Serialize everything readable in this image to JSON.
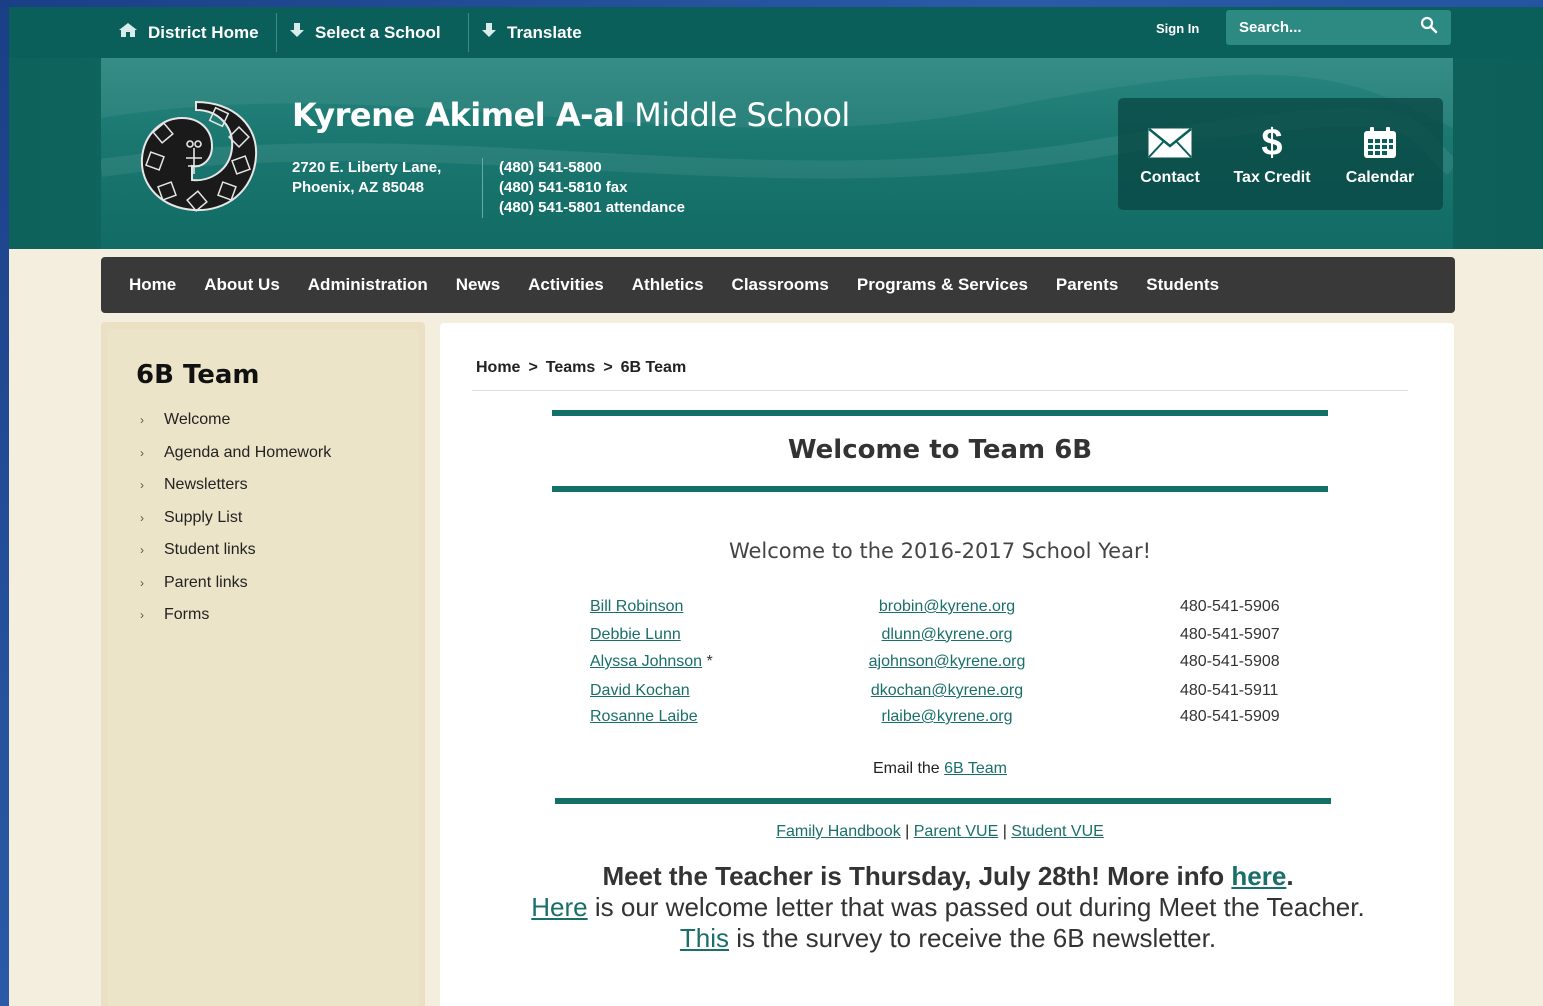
{
  "topbar": {
    "district_home": "District Home",
    "select_school": "Select a School",
    "translate": "Translate",
    "sign_in": "Sign In",
    "search_placeholder": "Search..."
  },
  "header": {
    "school_name_bold": "Kyrene Akimel A-al",
    "school_name_rest": "Middle School",
    "address_line1": "2720 E. Liberty Lane,",
    "address_line2": "Phoenix, AZ 85048",
    "phone": "(480) 541-5800",
    "fax": "(480) 541-5810 fax",
    "attendance": "(480) 541-5801 attendance",
    "quick_links": [
      {
        "label": "Contact",
        "icon": "envelope-icon"
      },
      {
        "label": "Tax Credit",
        "icon": "dollar-icon"
      },
      {
        "label": "Calendar",
        "icon": "calendar-icon"
      }
    ]
  },
  "nav": [
    "Home",
    "About Us",
    "Administration",
    "News",
    "Activities",
    "Athletics",
    "Classrooms",
    "Programs & Services",
    "Parents",
    "Students"
  ],
  "sidebar": {
    "title": "6B Team",
    "items": [
      "Welcome",
      "Agenda and Homework",
      "Newsletters",
      "Supply List",
      "Student links",
      "Parent links",
      "Forms"
    ]
  },
  "breadcrumb": [
    "Home",
    ">",
    "Teams",
    ">",
    "6B Team"
  ],
  "content": {
    "title": "Welcome to Team 6B",
    "year": "Welcome to the 2016-2017 School Year!",
    "staff": [
      {
        "name": "Bill Robinson",
        "star": "",
        "email": "brobin@kyrene.org",
        "phone": "480-541-5906"
      },
      {
        "name": "Debbie Lunn",
        "star": "",
        "email": "dlunn@kyrene.org",
        "phone": "480-541-5907"
      },
      {
        "name": "Alyssa Johnson",
        "star": " *",
        "email": "ajohnson@kyrene.org",
        "phone": "480-541-5908"
      },
      {
        "name": "David Kochan",
        "star": "",
        "email": "dkochan@kyrene.org",
        "phone": "480-541-5911"
      },
      {
        "name": "Rosanne Laibe",
        "star": "",
        "email": "rlaibe@kyrene.org",
        "phone": "480-541-5909"
      }
    ],
    "email_prefix": "Email the",
    "email_link": "6B Team",
    "links": [
      "Family Handbook",
      "Parent VUE",
      "Student VUE"
    ],
    "link_sep": "|",
    "meet_bold": "Meet the Teacher is Thursday, July 28th!  More info",
    "meet_link": "here",
    "meet_period": ".",
    "letter_link": "Here",
    "letter_text": "is our welcome letter that was passed out during Meet the Teacher.",
    "survey_link": "This",
    "survey_text": "is the survey to receive the 6B newsletter."
  },
  "colors": {
    "teal": "#0b5f5a",
    "nav_bg": "#393939",
    "link": "#1a6f6a",
    "sidebar_bg": "#ece4c9",
    "page_bg": "#f3eedd"
  }
}
